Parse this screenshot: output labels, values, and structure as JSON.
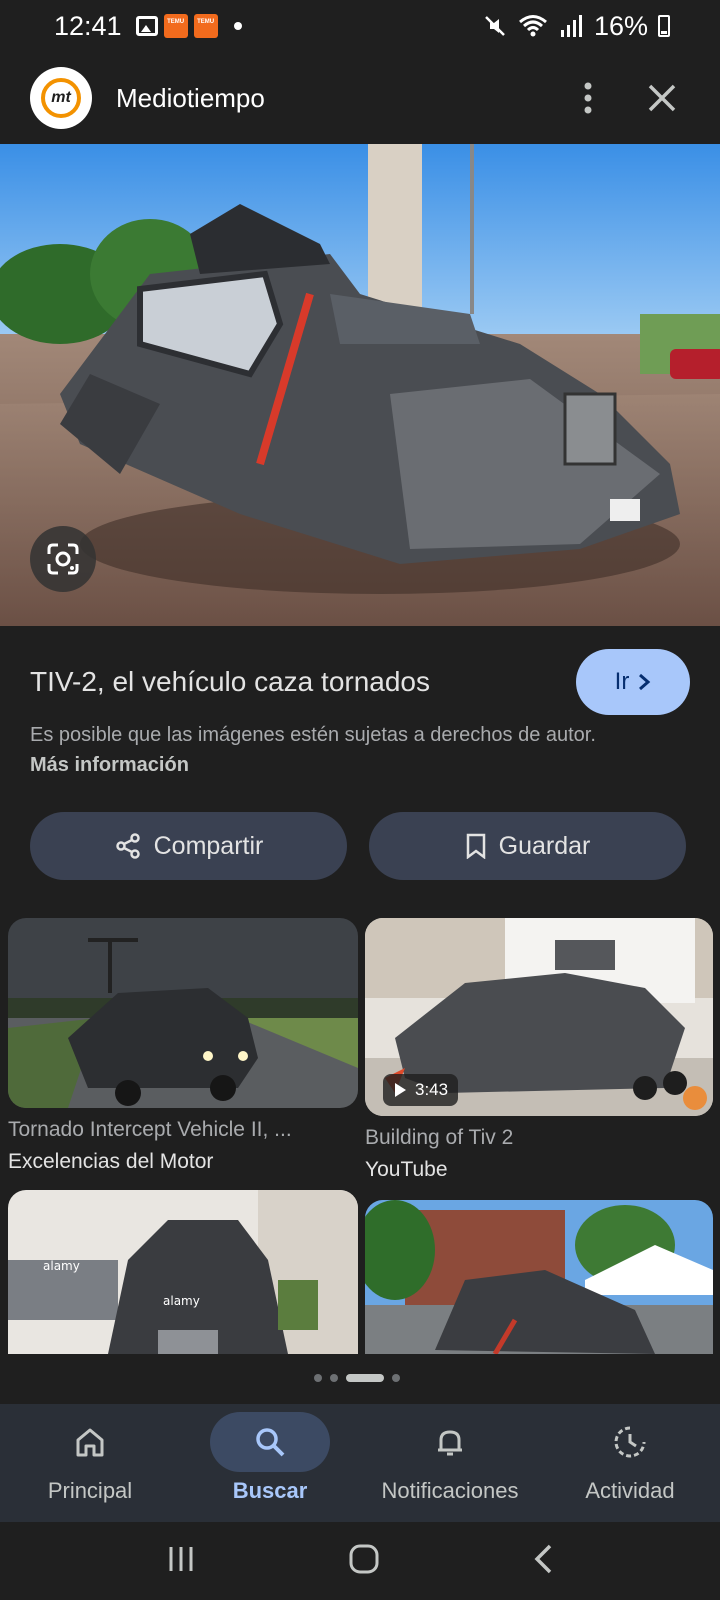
{
  "status_bar": {
    "time": "12:41",
    "temu_label": "TEMU",
    "battery": "16%"
  },
  "header": {
    "site_name": "Mediotiempo",
    "logo_text": "mt"
  },
  "result": {
    "title": "TIV-2, el vehículo caza tornados",
    "go_label": "Ir",
    "copyright_note": "Es posible que las imágenes estén sujetas a derechos de autor.",
    "more_info": "Más información",
    "share_label": "Compartir",
    "save_label": "Guardar"
  },
  "related": [
    {
      "title": "Tornado Intercept Vehicle II, ...",
      "source": "Excelencias del Motor"
    },
    {
      "title": "Building of Tiv 2",
      "source": "YouTube",
      "duration": "3:43"
    },
    {
      "watermark": "alamy"
    }
  ],
  "bottom_nav": {
    "items": [
      {
        "label": "Principal",
        "icon": "home-icon"
      },
      {
        "label": "Buscar",
        "icon": "search-icon",
        "active": true
      },
      {
        "label": "Notificaciones",
        "icon": "bell-icon"
      },
      {
        "label": "Actividad",
        "icon": "activity-icon"
      }
    ]
  },
  "colors": {
    "background": "#1f1f1f",
    "accent": "#a8c7fa",
    "button_bg": "#3a4152",
    "nav_bg": "#2a2f37"
  }
}
